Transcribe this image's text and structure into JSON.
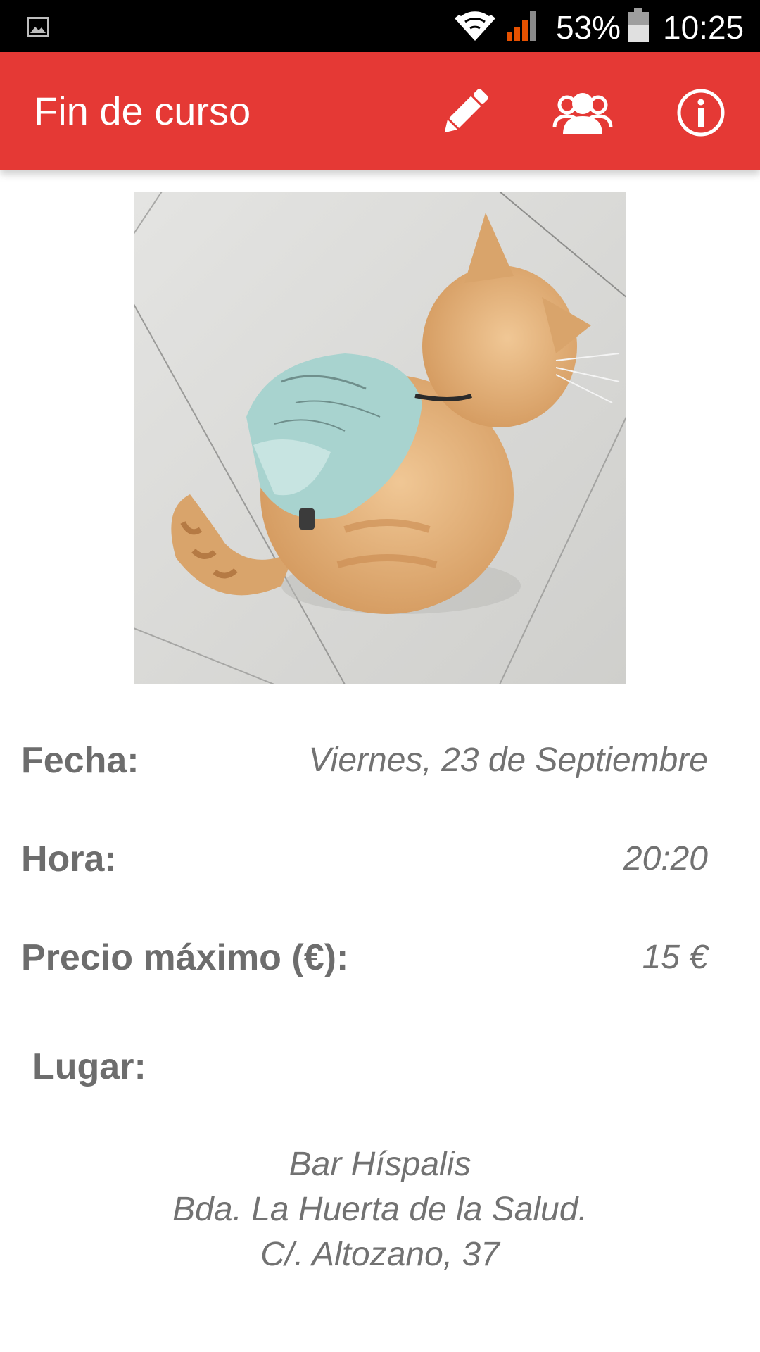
{
  "status_bar": {
    "battery_percent": "53%",
    "time": "10:25",
    "icons": [
      "gallery-icon",
      "wifi-icon",
      "signal-icon",
      "battery-icon"
    ]
  },
  "app_bar": {
    "title": "Fin de curso",
    "color": "#e53935",
    "actions": [
      "pencil-icon",
      "group-icon",
      "info-icon"
    ]
  },
  "event": {
    "image": "cat-with-map-backpack",
    "fecha_label": "Fecha:",
    "fecha_value": "Viernes, 23 de Septiembre",
    "hora_label": "Hora:",
    "hora_value": "20:20",
    "precio_label": "Precio máximo (€):",
    "precio_value": "15 €",
    "lugar_label": "Lugar:",
    "lugar_lines": [
      "Bar Híspalis",
      "Bda. La Huerta de la Salud.",
      "C/. Altozano, 37"
    ]
  }
}
